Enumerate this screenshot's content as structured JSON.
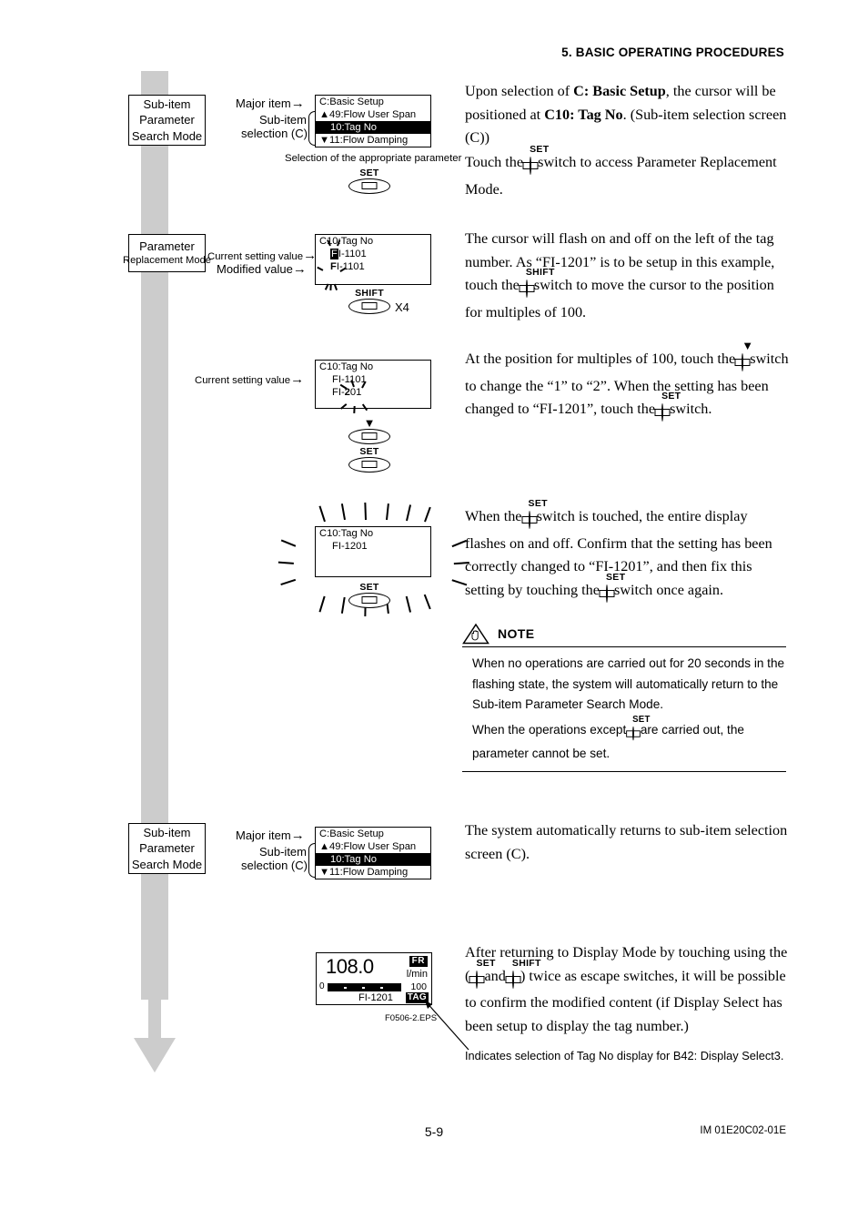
{
  "header": {
    "section": "5.  BASIC OPERATING PROCEDURES"
  },
  "footer": {
    "page": "5-9",
    "doc_number": "IM 01E20C02-01E"
  },
  "figure_code": "F0506-2.EPS",
  "mode_boxes": {
    "search_mode": {
      "line1": "Sub-item",
      "line2": "Parameter",
      "line3": "Search Mode"
    },
    "replacement_mode": {
      "line1": "Parameter",
      "line2": "Replacement Mode"
    },
    "search_mode_2": {
      "line1": "Sub-item",
      "line2": "Parameter",
      "line3": "Search Mode"
    }
  },
  "callouts": {
    "major_item": "Major item",
    "sub_item_1": "Sub-item",
    "sub_item_2": "selection (C)",
    "selection_note": "Selection of the appropriate parameter",
    "current_setting_value": "Current setting value",
    "modified_value": "Modified value",
    "current_setting_value_2": "Current setting value",
    "shift_multiplier": "X4"
  },
  "lcd_selection": {
    "line1": "C:Basic Setup",
    "line2": "49:Flow User Span",
    "line2_arrow": "▲",
    "line3": "10:Tag No",
    "line4": "11:Flow Damping",
    "line4_arrow": "▼"
  },
  "lcd_replace": {
    "title": "C10:Tag No",
    "current": "FI-1101",
    "modified": "FI-1101",
    "cursor_char": "F"
  },
  "lcd_change": {
    "title": "C10:Tag No",
    "current": "FI-1101",
    "modified": "FI-1201",
    "flash_digit": "2"
  },
  "lcd_flash": {
    "title": "C10:Tag No",
    "value": "FI-1201"
  },
  "lcd_selection_2": {
    "line1": "C:Basic Setup",
    "line2": "49:Flow User Span",
    "line2_arrow": "▲",
    "line3": "10:Tag No",
    "line4": "11:Flow Damping",
    "line4_arrow": "▼"
  },
  "display_mode_lcd": {
    "value": "108.0",
    "mode_badge": "FR",
    "unit": "l/min",
    "bar_min": "0",
    "bar_max": "100",
    "tag_number": "FI-1201",
    "tag_badge": "TAG"
  },
  "switches": {
    "set": "SET",
    "shift": "SHIFT",
    "down": "▼"
  },
  "paragraphs": {
    "p1_a": "Upon selection of ",
    "p1_b": "C: Basic Setup",
    "p1_c": ", the cursor will be positioned at ",
    "p1_d": "C10: Tag No",
    "p1_e": ". (Sub-item selection screen (C))",
    "p2_a": "Touch the",
    "p2_b": "switch to access Parameter Replacement Mode.",
    "p3_a": "The cursor will flash on and off on the left of the tag number. As “FI-1201” is to be setup in this example, touch the",
    "p3_b": "switch to move the cursor to the position for multiples of 100.",
    "p4_a": "At the position for multiples of 100, touch the",
    "p4_b": "switch to change the “1” to “2”. When the setting has been changed to “FI-1201”, touch the",
    "p4_c": "switch.",
    "p5_a": "When the",
    "p5_b": "switch is touched, the entire display flashes on and off. Confirm that the setting has been correctly changed to “FI-1201”, and then fix this setting by touching the",
    "p5_c": "switch once again.",
    "p6": "The system automatically returns to sub-item selection screen (C).",
    "p7_a": "After returning to Display Mode by touching using the (",
    "p7_b": "and",
    "p7_c": ") twice as escape switches, it will be possible to confirm the modified content (if Display Select has been setup to display the tag number.)"
  },
  "note": {
    "title": "NOTE",
    "body_1": "When no operations are carried out for 20 seconds in the flashing state, the system will automatically return to the Sub-item Parameter Search Mode.",
    "body_2_a": "When the operations except",
    "body_2_b": "are carried out, the parameter cannot be set."
  },
  "bottom_caption": "Indicates selection of Tag No display for B42: Display Select3."
}
